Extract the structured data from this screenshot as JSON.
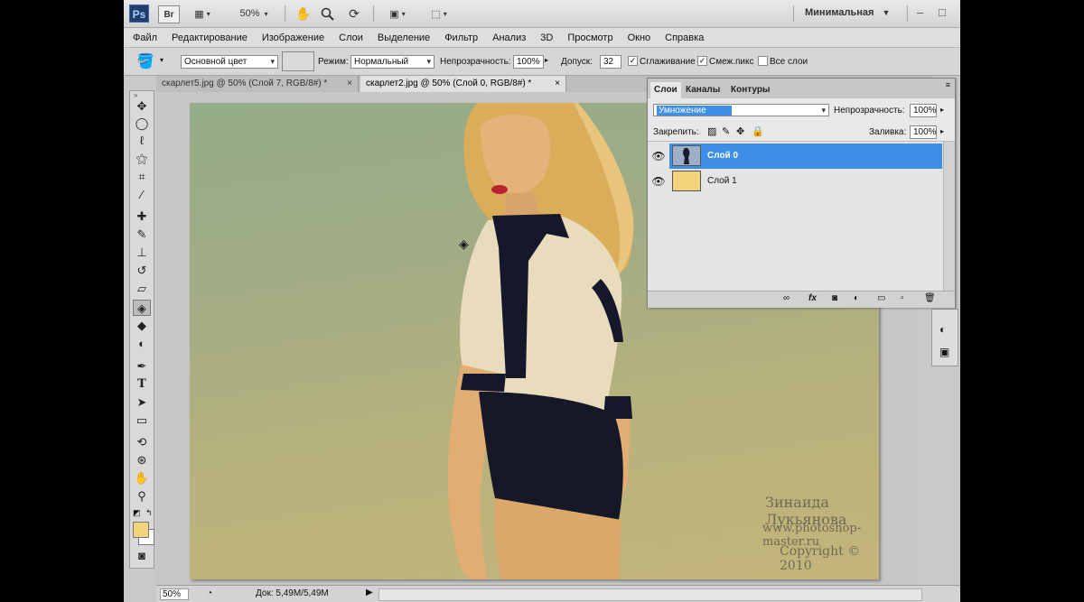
{
  "app": {
    "logo": "Ps",
    "bridge_label": "Br",
    "zoom_value": "50%",
    "workspace": "Минимальная",
    "toolbar_icons": [
      "frame-icon",
      "hand-icon",
      "zoom-icon",
      "rotate-icon",
      "arrange-icon",
      "screen-mode-icon"
    ],
    "window_controls": [
      "–",
      "□"
    ]
  },
  "menu": [
    "Файл",
    "Редактирование",
    "Изображение",
    "Слои",
    "Выделение",
    "Фильтр",
    "Анализ",
    "3D",
    "Просмотр",
    "Окно",
    "Справка"
  ],
  "options": {
    "fill_source": "Основной цвет",
    "mode_label": "Режим:",
    "mode_value": "Нормальный",
    "opacity_label": "Непрозрачность:",
    "opacity_value": "100%",
    "tolerance_label": "Допуск:",
    "tolerance_value": "32",
    "antialias_label": "Сглаживание",
    "antialias_checked": true,
    "contiguous_label": "Смеж.пикс",
    "contiguous_checked": true,
    "all_layers_label": "Все слои",
    "all_layers_checked": false
  },
  "tabs": [
    {
      "label": "скарлет5.jpg @ 50% (Слой 7, RGB/8#) *",
      "close": "×",
      "active": false
    },
    {
      "label": "скарлет2.jpg @ 50% (Слой 0, RGB/8#) *",
      "close": "×",
      "active": true
    }
  ],
  "tools": [
    "move-icon",
    "marquee-icon",
    "lasso-icon",
    "magic-wand-icon",
    "crop-icon",
    "eyedropper-icon",
    "healing-brush-icon",
    "brush-icon",
    "clone-stamp-icon",
    "history-brush-icon",
    "eraser-icon",
    "paint-bucket-icon",
    "blur-icon",
    "dodge-icon",
    "pen-icon",
    "type-icon",
    "path-selection-icon",
    "rectangle-icon",
    "3d-rotate-icon",
    "3d-orbit-icon",
    "hand-icon",
    "zoom-icon"
  ],
  "tool_glyphs": {
    "type": "T"
  },
  "colors": {
    "foreground": "#f2d27a",
    "background": "#ffffff",
    "accent": "#3d8fe8"
  },
  "layers_panel": {
    "tabs": [
      "Слои",
      "Каналы",
      "Контуры"
    ],
    "blend_mode": "Умножение",
    "opacity_label": "Непрозрачность:",
    "opacity_value": "100%",
    "lock_label": "Закрепить:",
    "fill_label": "Заливка:",
    "fill_value": "100%",
    "layers": [
      {
        "name": "Слой 0",
        "selected": true,
        "thumb": "photo"
      },
      {
        "name": "Слой 1",
        "selected": false,
        "thumb": "#f3d27c"
      }
    ],
    "footer_icons": [
      "link-icon",
      "fx-icon",
      "mask-icon",
      "adjustment-icon",
      "group-icon",
      "new-layer-icon",
      "trash-icon"
    ]
  },
  "watermark": {
    "author": "Зинаида Лукьянова",
    "site": "www.photoshop-master.ru",
    "copyright": "Copyright © 2010"
  },
  "status": {
    "zoom": "50%",
    "doc": "Док: 5,49M/5,49M"
  }
}
